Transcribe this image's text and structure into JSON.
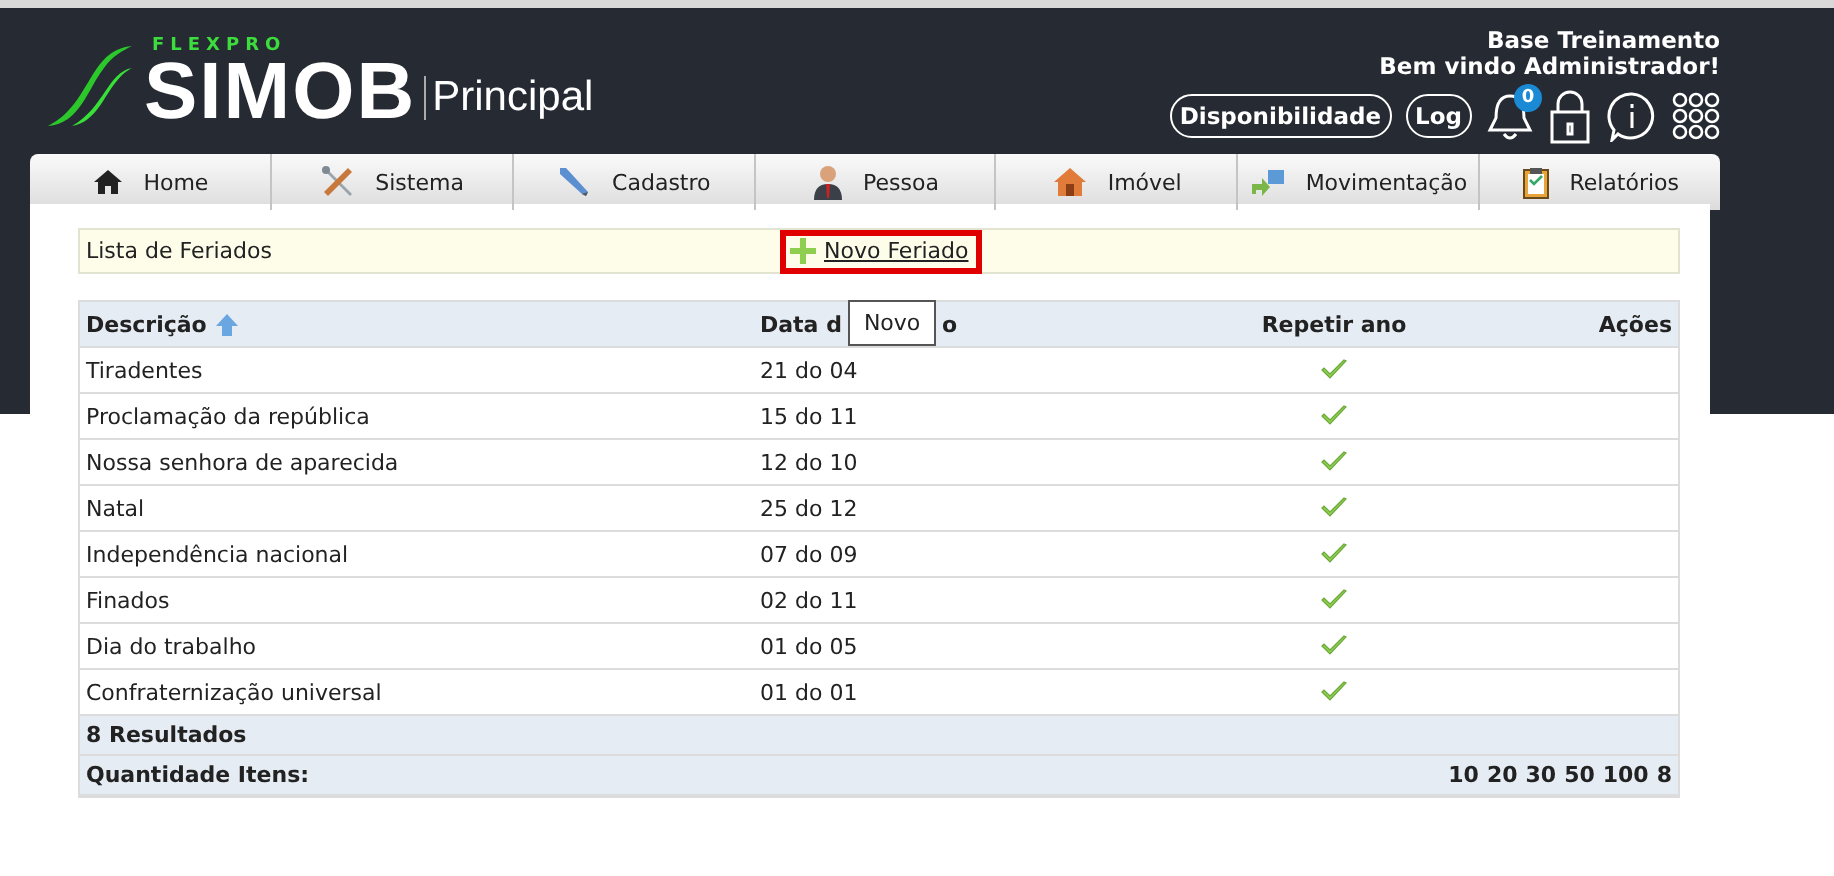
{
  "brand": {
    "tagline": "FLEXPRO",
    "name": "SIMOB",
    "section": "Principal"
  },
  "user": {
    "base": "Base Treinamento",
    "welcome": "Bem vindo Administrador!"
  },
  "toolbar": {
    "buttons": [
      "Disponibilidade",
      "Log"
    ],
    "notifications": "0"
  },
  "nav": [
    {
      "label": "Home"
    },
    {
      "label": "Sistema"
    },
    {
      "label": "Cadastro"
    },
    {
      "label": "Pessoa"
    },
    {
      "label": "Imóvel"
    },
    {
      "label": "Movimentação"
    },
    {
      "label": "Relatórios"
    }
  ],
  "list": {
    "title": "Lista de Feriados",
    "new_link": "Novo Feriado",
    "tooltip": "Novo"
  },
  "table": {
    "columns": [
      {
        "label": "Descrição",
        "sorted": true
      },
      {
        "label": "Data d",
        "label_after": "o",
        "sorted": false
      },
      {
        "label": "Repetir ano",
        "sorted": false
      },
      {
        "label": "Ações",
        "sorted": false
      }
    ],
    "rows": [
      {
        "description": "Tiradentes",
        "date": "21 do 04",
        "repeat": true
      },
      {
        "description": "Proclamação da república",
        "date": "15 do 11",
        "repeat": true
      },
      {
        "description": "Nossa senhora de aparecida",
        "date": "12 do 10",
        "repeat": true
      },
      {
        "description": "Natal",
        "date": "25 do 12",
        "repeat": true
      },
      {
        "description": "Independência nacional",
        "date": "07 do 09",
        "repeat": true
      },
      {
        "description": "Finados",
        "date": "02 do 11",
        "repeat": true
      },
      {
        "description": "Dia do trabalho",
        "date": "01 do 05",
        "repeat": true
      },
      {
        "description": "Confraternização universal",
        "date": "01 do 01",
        "repeat": true
      }
    ],
    "results": "8 Resultados",
    "quantity_label": "Quantidade Itens:",
    "page_sizes": [
      "10",
      "20",
      "30",
      "50",
      "100",
      "8"
    ]
  }
}
